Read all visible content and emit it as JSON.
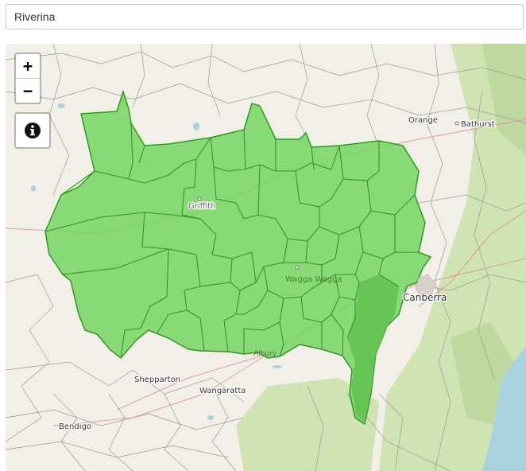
{
  "search": {
    "value": "Riverina"
  },
  "map": {
    "region_name": "Riverina",
    "region_color": "#74d660",
    "region_border_color": "#2f9a22",
    "base_color": "#f2efe9",
    "forest_color": "#cfe3b3",
    "water_color": "#aad3df",
    "labels": {
      "orange": "Orange",
      "bathurst": "Bathurst",
      "griffith": "Griffith",
      "wagga": "Wagga Wagga",
      "canberra": "Canberra",
      "shepparton": "Shepparton",
      "wangaratta": "Wangaratta",
      "albury": "Albury",
      "bendigo": "Bendigo"
    }
  },
  "controls": {
    "zoom_in_label": "+",
    "zoom_out_label": "−",
    "info_icon": "info-circle-icon"
  }
}
